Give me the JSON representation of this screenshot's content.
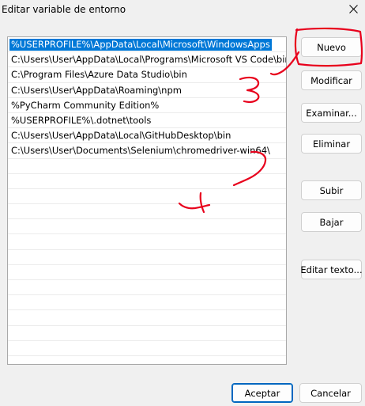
{
  "window": {
    "title": "Editar variable de entorno"
  },
  "list": {
    "items": [
      "%USERPROFILE%\\AppData\\Local\\Microsoft\\WindowsApps",
      "C:\\Users\\User\\AppData\\Local\\Programs\\Microsoft VS Code\\bin",
      "C:\\Program Files\\Azure Data Studio\\bin",
      "C:\\Users\\User\\AppData\\Roaming\\npm",
      "%PyCharm Community Edition%",
      "%USERPROFILE%\\.dotnet\\tools",
      "C:\\Users\\User\\AppData\\Local\\GitHubDesktop\\bin",
      "C:\\Users\\User\\Documents\\Selenium\\chromedriver-win64\\"
    ],
    "selected_index": 0,
    "selection_color": "#0078d7"
  },
  "buttons": {
    "new": "Nuevo",
    "edit": "Modificar",
    "browse": "Examinar...",
    "delete": "Eliminar",
    "up": "Subir",
    "down": "Bajar",
    "edit_text": "Editar texto...",
    "ok": "Aceptar",
    "cancel": "Cancelar"
  },
  "annotations": {
    "ink_color": "#e8001c",
    "marks": [
      "3",
      "4"
    ]
  }
}
